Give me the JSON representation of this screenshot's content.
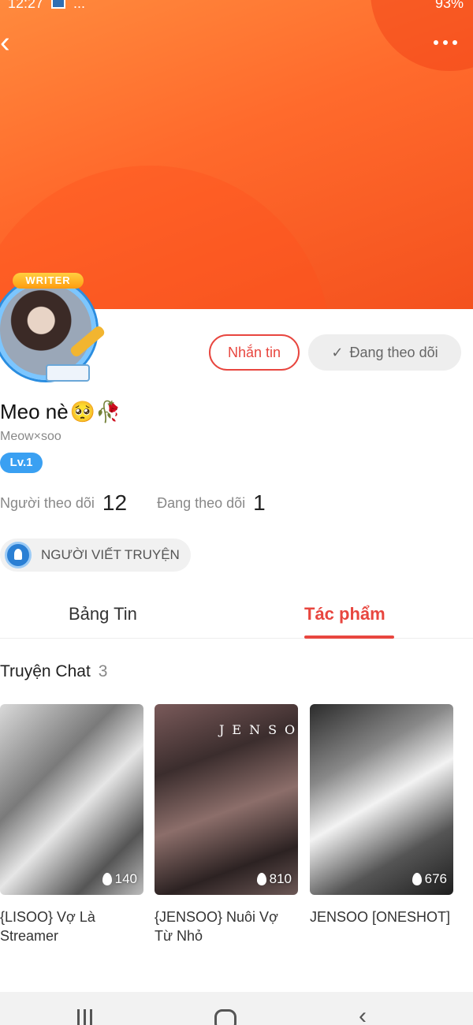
{
  "status_bar": {
    "time": "12:27",
    "dots": "...",
    "battery": "93%"
  },
  "header": {
    "back_icon": "chevron-left-icon",
    "more_icon": "more-dots-icon",
    "colors": {
      "start": "#ff8a3d",
      "end": "#f4511e"
    }
  },
  "profile": {
    "badge": "WRITER",
    "name": "Meo nè",
    "name_emoji": "🥺🥀",
    "username": "Meow×soo",
    "level": "Lv.1",
    "followers_label": "Người theo dõi",
    "followers_count": "12",
    "following_label": "Đang theo dõi",
    "following_count": "1",
    "role": "NGƯỜI VIẾT TRUYỆN"
  },
  "actions": {
    "message": "Nhắn tin",
    "following": "Đang theo dõi"
  },
  "tabs": [
    {
      "label": "Bảng Tin"
    },
    {
      "label": "Tác phẩm",
      "active": true
    }
  ],
  "section": {
    "title": "Truyện Chat",
    "count": "3"
  },
  "stories": [
    {
      "title": "{LISOO} Vợ Là Streamer",
      "views": "140"
    },
    {
      "title": "{JENSOO} Nuôi Vợ Từ Nhỏ",
      "views": "810",
      "cover_text": "JENSOO"
    },
    {
      "title": "JENSOO [ONESHOT]",
      "views": "676"
    }
  ],
  "accent_color": "#e8463f"
}
